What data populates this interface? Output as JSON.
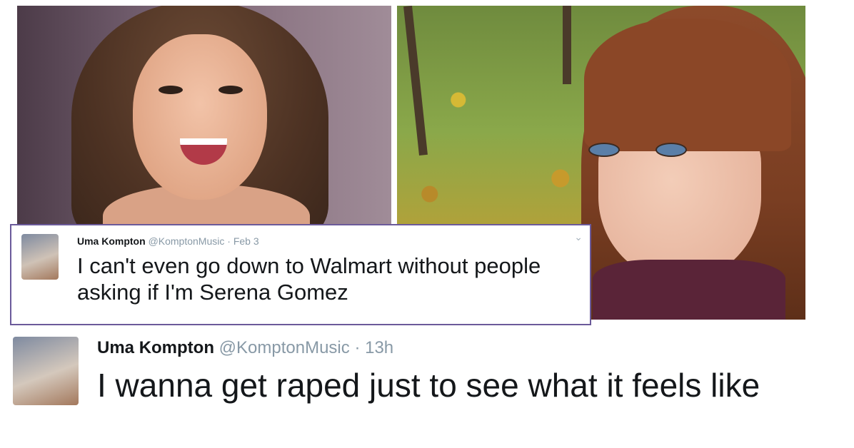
{
  "tweet_small": {
    "display_name": "Uma Kompton",
    "handle": "@KomptonMusic",
    "separator": "·",
    "time": "Feb 3",
    "text": "I can't even go down to Walmart without people asking if I'm Serena Gomez",
    "menu_icon": "chevron-down-icon"
  },
  "tweet_large": {
    "display_name": "Uma Kompton",
    "handle": "@KomptonMusic",
    "separator": "·",
    "time": "13h",
    "text": "I wanna get raped just to see what it feels like"
  },
  "colors": {
    "card_border": "#6b5a9a",
    "text": "#14171a",
    "meta": "#8899a6"
  }
}
